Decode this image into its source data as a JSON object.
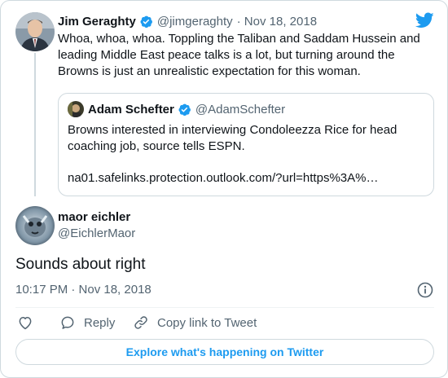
{
  "quoted_tweet": {
    "author_name": "Jim Geraghty",
    "author_handle": "@jimgeraghty",
    "date": "· Nov 18, 2018",
    "text": "Whoa, whoa, whoa. Toppling the Taliban and Saddam Hussein and leading Middle East peace talks is a lot, but turning around the Browns is just an unrealistic expectation for this woman.",
    "embedded": {
      "author_name": "Adam Schefter",
      "author_handle": "@AdamSchefter",
      "text": "Browns interested in interviewing Condoleezza Rice for head coaching job, source tells ESPN.",
      "link": "na01.safelinks.protection.outlook.com/?url=https%3A%…"
    }
  },
  "main_tweet": {
    "author_name": "maor eichler",
    "author_handle": "@EichlerMaor",
    "text": "Sounds about right",
    "timestamp": "10:17 PM · Nov 18, 2018"
  },
  "actions": {
    "reply": "Reply",
    "copy_link": "Copy link to Tweet"
  },
  "explore_label": "Explore what's happening on Twitter",
  "icons": {
    "brand": "twitter-bird-icon",
    "verified": "verified-badge-icon",
    "info": "info-icon",
    "like": "heart-icon",
    "reply": "reply-bubble-icon",
    "link": "link-icon"
  },
  "colors": {
    "accent": "#1d9bf0",
    "text": "#0f1419",
    "muted": "#536471",
    "border": "#cfd9de"
  }
}
